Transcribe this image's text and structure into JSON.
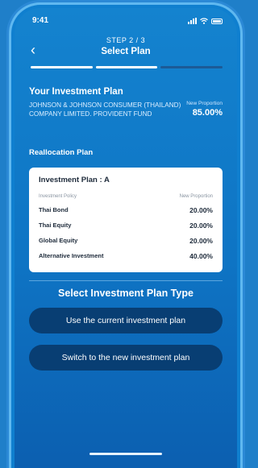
{
  "status_bar": {
    "time": "9:41"
  },
  "header": {
    "back_icon": "chevron-left-icon",
    "step": "STEP 2 / 3",
    "title": "Select Plan"
  },
  "progress": {
    "total_steps": 3,
    "current_step": 2
  },
  "your_plan": {
    "title": "Your Investment Plan",
    "company": "JOHNSON & JOHNSON CONSUMER (THAILAND) COMPANY LIMITED. PROVIDENT FUND",
    "proportion_label": "New Proportion",
    "proportion_value": "85.00%"
  },
  "reallocation": {
    "title": "Reallocation Plan",
    "card_title": "Investment Plan : A",
    "policy_header": "Investment Policy",
    "proportion_header": "New Proportion",
    "rows": [
      {
        "name": "Thai Bond",
        "value": "20.00%"
      },
      {
        "name": "Thai Equity",
        "value": "20.00%"
      },
      {
        "name": "Global Equity",
        "value": "20.00%"
      },
      {
        "name": "Alternative Investment",
        "value": "40.00%"
      }
    ]
  },
  "select_type": {
    "title": "Select Investment Plan Type",
    "current_button": "Use the current investment plan",
    "new_button": "Switch to the new investment plan"
  },
  "colors": {
    "background": "#0e74c4",
    "button": "#083e73",
    "card": "#ffffff"
  }
}
